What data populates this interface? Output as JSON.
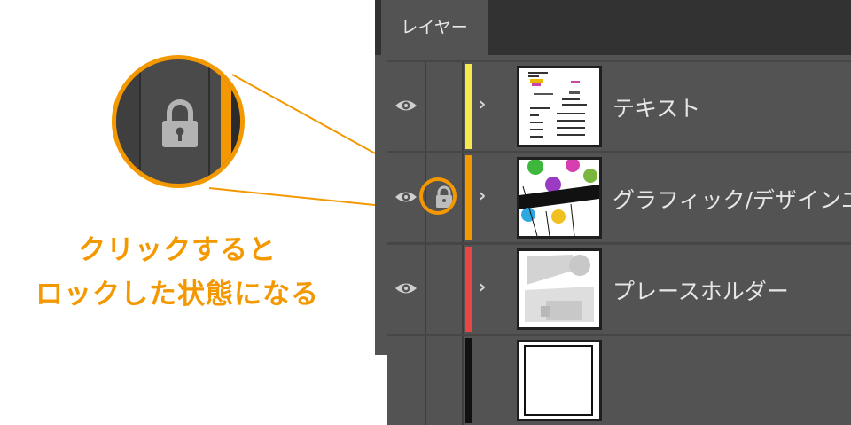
{
  "panel": {
    "tab_label": "レイヤー"
  },
  "layers": [
    {
      "name": "テキスト",
      "color": "#f5e94e",
      "locked": false,
      "visible": true,
      "icon": "text-thumbnail"
    },
    {
      "name": "グラフィック/デザインエ",
      "color": "#f39800",
      "locked": true,
      "visible": true,
      "icon": "graphic-thumbnail"
    },
    {
      "name": "プレースホルダー",
      "color": "#e94545",
      "locked": false,
      "visible": true,
      "icon": "placeholder-thumbnail"
    },
    {
      "name": "",
      "color": "#111111",
      "locked": false,
      "visible": true,
      "icon": "blank-thumbnail"
    }
  ],
  "annotation": {
    "line1": "クリックすると",
    "line2": "ロックした状態になる",
    "accent": "#f39800",
    "zoom_icon": "lock-icon"
  }
}
